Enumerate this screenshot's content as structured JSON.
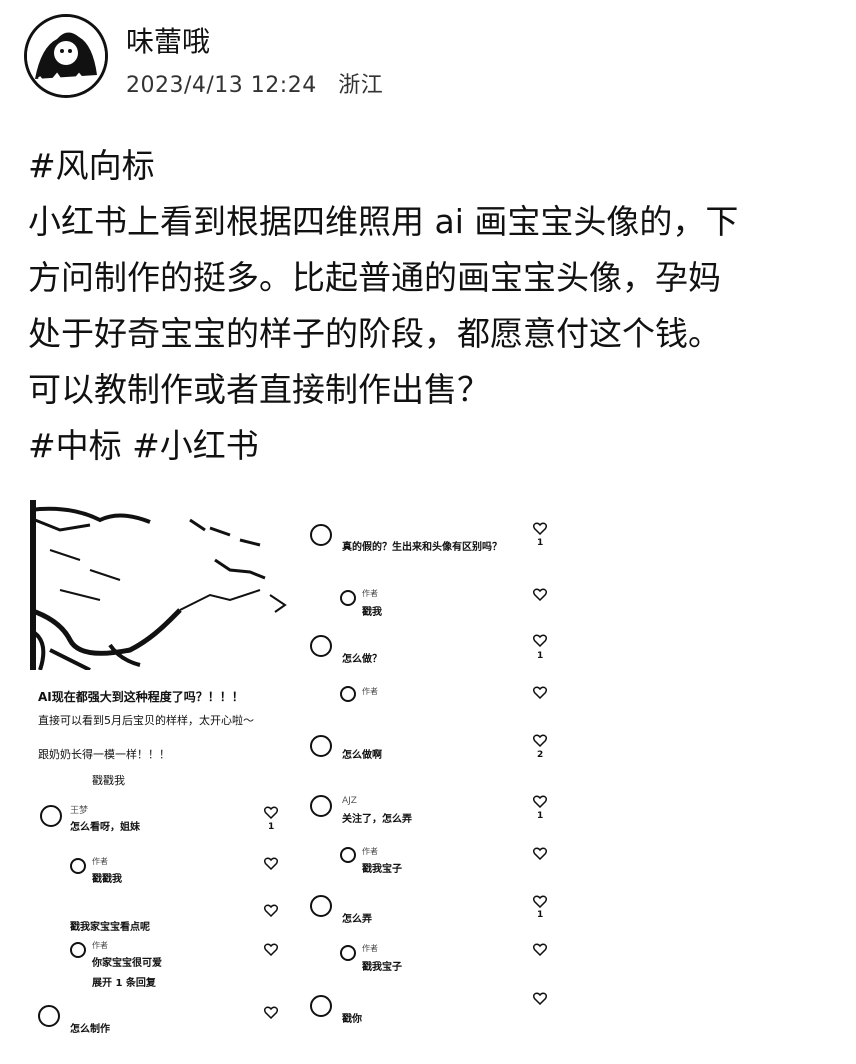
{
  "post": {
    "author": "味蕾哦",
    "date": "2023/4/13 12:24",
    "location": "浙江",
    "lines": [
      "#风向标",
      "小红书上看到根据四维照用 ai 画宝宝头像的，下",
      "方问制作的挺多。比起普通的画宝宝头像，孕妈",
      "处于好奇宝宝的样子的阶段，都愿意付这个钱。",
      "可以教制作或者直接制作出售？",
      "#中标 #小红书"
    ]
  },
  "screenshot": {
    "caption": "AI现在都强大到这种程度了吗？！！！",
    "caption2": "直接可以看到5月后宝贝的样样，太开心啦～",
    "caption3": "跟奶奶长得一模一样！！！",
    "caption4": "戳戳我",
    "left_comments": [
      {
        "name": "王梦",
        "text": "怎么看呀，姐妹",
        "count": "1"
      },
      {
        "name": "作者",
        "text": "戳戳我",
        "count": ""
      },
      {
        "name": "",
        "text": "戳我家宝宝看点呢",
        "count": ""
      },
      {
        "name": "作者",
        "text": "你家宝宝很可爱",
        "count": ""
      },
      {
        "name": "",
        "text": "展开 1 条回复",
        "count": ""
      },
      {
        "name": "",
        "text": "怎么制作",
        "count": ""
      }
    ],
    "right_comments": [
      {
        "name": "",
        "text": "真的假的？生出来和头像有区别吗？",
        "count": "1"
      },
      {
        "name": "作者",
        "text": "戳我",
        "count": ""
      },
      {
        "name": "",
        "text": "怎么做？",
        "count": "1"
      },
      {
        "name": "作者",
        "text": "",
        "count": ""
      },
      {
        "name": "",
        "text": "怎么做啊",
        "count": "2"
      },
      {
        "name": "AJZ",
        "text": "关注了，怎么弄",
        "count": "1"
      },
      {
        "name": "作者",
        "text": "戳我宝子",
        "count": ""
      },
      {
        "name": "",
        "text": "怎么弄",
        "count": "1"
      },
      {
        "name": "作者",
        "text": "戳我宝子",
        "count": ""
      },
      {
        "name": "",
        "text": "戳你",
        "count": ""
      }
    ]
  }
}
